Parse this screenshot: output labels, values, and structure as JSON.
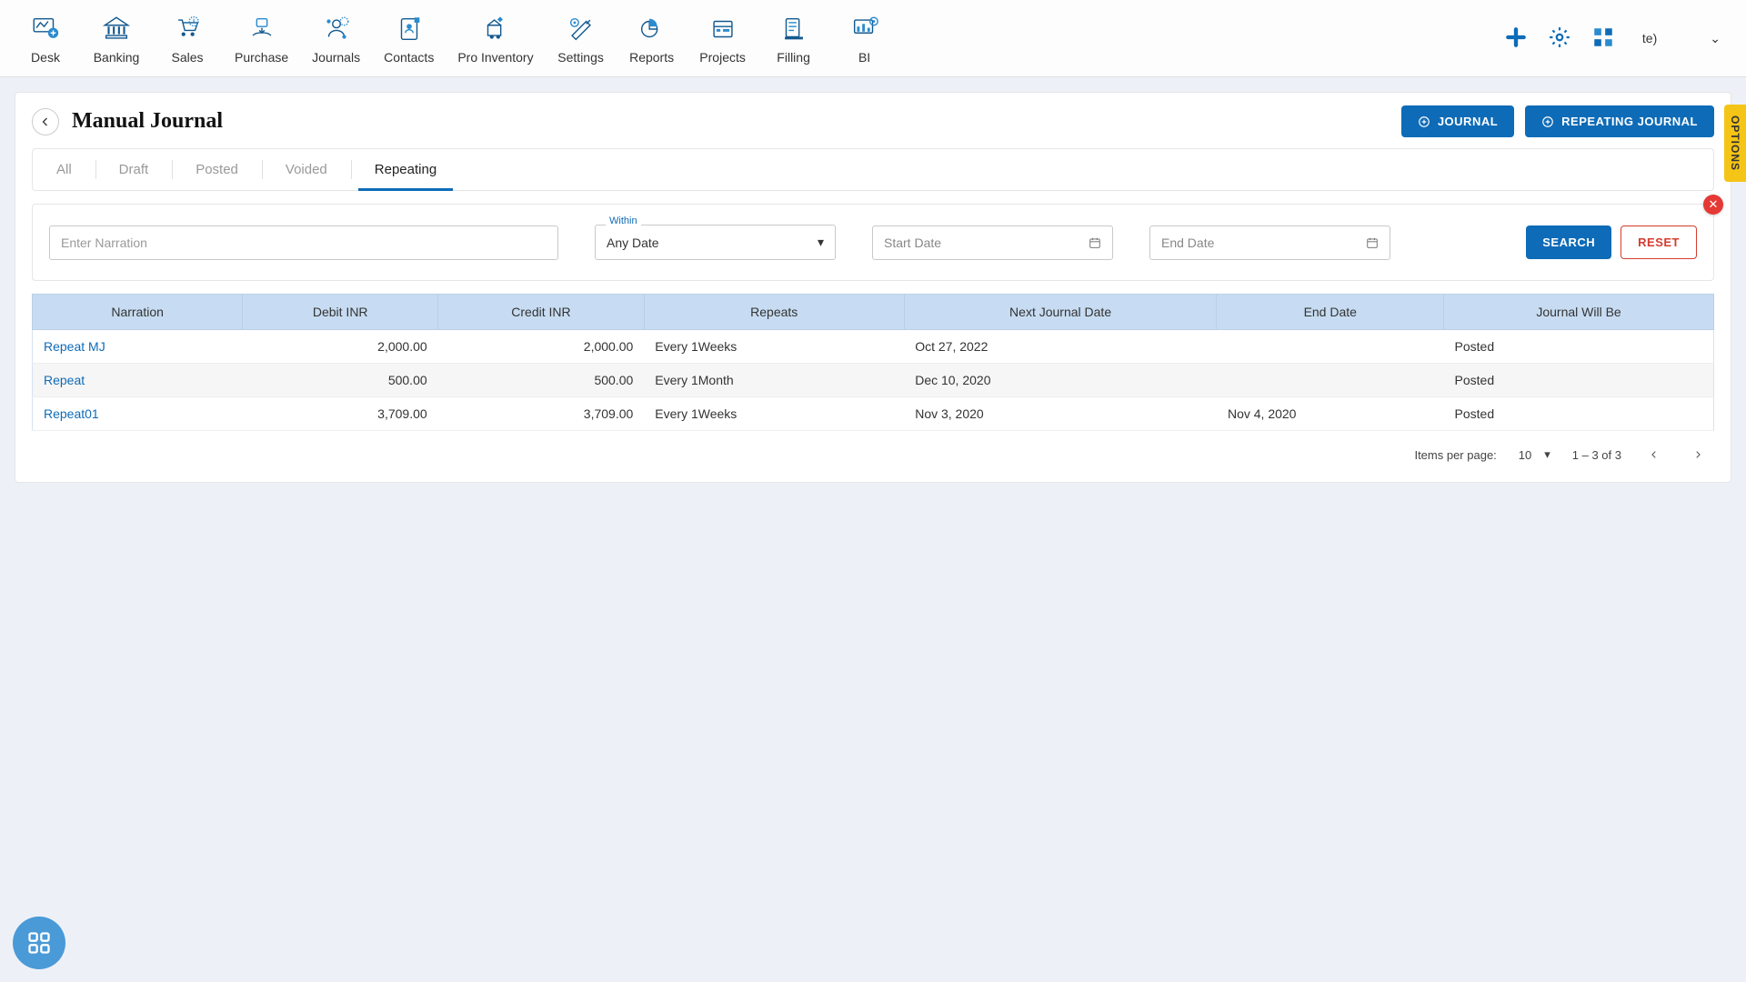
{
  "nav": {
    "items": [
      {
        "label": "Desk"
      },
      {
        "label": "Banking"
      },
      {
        "label": "Sales"
      },
      {
        "label": "Purchase"
      },
      {
        "label": "Journals"
      },
      {
        "label": "Contacts"
      },
      {
        "label": "Pro Inventory"
      },
      {
        "label": "Settings"
      },
      {
        "label": "Reports"
      },
      {
        "label": "Projects"
      },
      {
        "label": "Filling"
      },
      {
        "label": "BI"
      }
    ],
    "user": "te)"
  },
  "page": {
    "title": "Manual Journal",
    "buttons": {
      "journal": "JOURNAL",
      "repeating": "REPEATING JOURNAL"
    }
  },
  "tabs": [
    "All",
    "Draft",
    "Posted",
    "Voided",
    "Repeating"
  ],
  "active_tab": 4,
  "filter": {
    "narration_placeholder": "Enter Narration",
    "within_label": "Within",
    "within_value": "Any Date",
    "start_placeholder": "Start Date",
    "end_placeholder": "End Date",
    "search": "SEARCH",
    "reset": "RESET"
  },
  "table": {
    "headers": [
      "Narration",
      "Debit INR",
      "Credit INR",
      "Repeats",
      "Next Journal Date",
      "End Date",
      "Journal Will Be"
    ],
    "rows": [
      {
        "narration": "Repeat MJ",
        "debit": "2,000.00",
        "credit": "2,000.00",
        "repeats": "Every 1Weeks",
        "next": "Oct 27, 2022",
        "end": "",
        "status": "Posted"
      },
      {
        "narration": "Repeat",
        "debit": "500.00",
        "credit": "500.00",
        "repeats": "Every 1Month",
        "next": "Dec 10, 2020",
        "end": "",
        "status": "Posted"
      },
      {
        "narration": "Repeat01",
        "debit": "3,709.00",
        "credit": "3,709.00",
        "repeats": "Every 1Weeks",
        "next": "Nov 3, 2020",
        "end": "Nov 4, 2020",
        "status": "Posted"
      }
    ]
  },
  "pagination": {
    "ipp_label": "Items per page:",
    "ipp_value": "10",
    "range": "1 – 3 of 3"
  },
  "options_label": "OPTIONS"
}
